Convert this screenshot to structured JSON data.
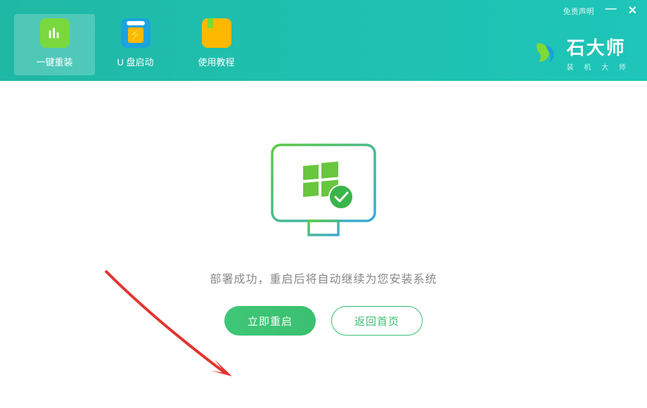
{
  "titlebar": {
    "disclaimer": "免责声明"
  },
  "tabs": [
    {
      "label": "一键重装",
      "active": true
    },
    {
      "label": "U 盘启动",
      "active": false
    },
    {
      "label": "使用教程",
      "active": false
    }
  ],
  "brand": {
    "title": "石大师",
    "subtitle": "装 机 大 师"
  },
  "main": {
    "message": "部署成功，重启后将自动继续为您安装系统",
    "primary_button": "立即重启",
    "secondary_button": "返回首页"
  }
}
